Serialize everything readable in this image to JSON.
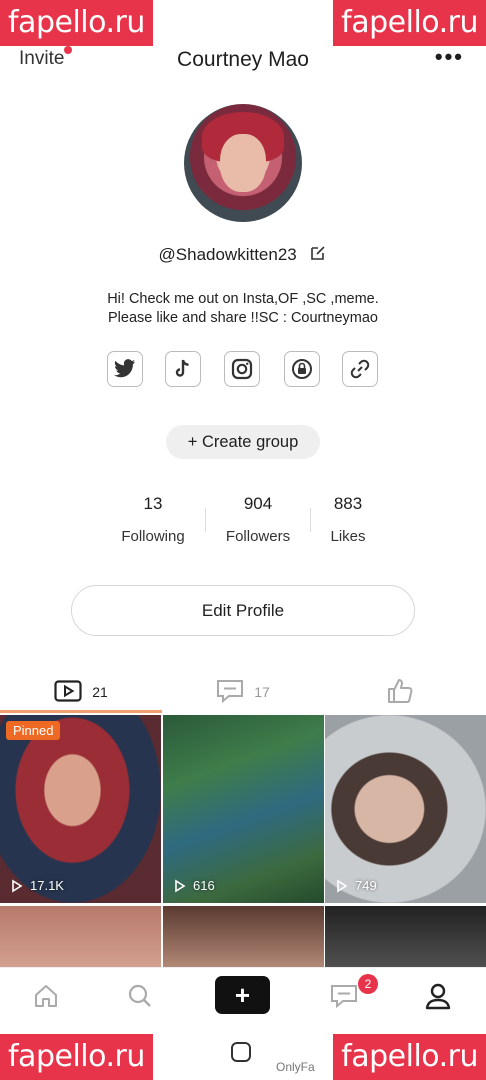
{
  "watermarks": {
    "text": "fapello.ru"
  },
  "header": {
    "invite_label": "Invite",
    "title": "Courtney Mao",
    "more_label": "•••"
  },
  "profile": {
    "username": "@Shadowkitten23",
    "bio_line1": "Hi! Check me out on Insta,OF ,SC ,meme.",
    "bio_line2": "Please like and share !!SC : Courtneymao",
    "socials": [
      "twitter-icon",
      "tiktok-icon",
      "instagram-icon",
      "onlyfans-icon",
      "link-icon"
    ],
    "create_group_label": "+ Create group"
  },
  "stats": [
    {
      "value": "13",
      "label": "Following"
    },
    {
      "value": "904",
      "label": "Followers"
    },
    {
      "value": "883",
      "label": "Likes"
    }
  ],
  "edit_profile_label": "Edit Profile",
  "tabs": [
    {
      "icon": "video-icon",
      "count": "21"
    },
    {
      "icon": "comment-icon",
      "count": "17"
    },
    {
      "icon": "like-icon",
      "count": ""
    }
  ],
  "videos": [
    {
      "pinned_label": "Pinned",
      "views": "17.1K"
    },
    {
      "views": "616"
    },
    {
      "views": "749"
    }
  ],
  "bottom_nav": {
    "items": [
      "home-icon",
      "search-icon",
      "create-icon",
      "messages-icon",
      "profile-icon"
    ],
    "messages_badge": "2",
    "create_label": "+"
  },
  "system_nav": {
    "app_label": "OnlyFa"
  },
  "colors": {
    "accent": "#e8344a",
    "pinned": "#ee6a24",
    "tab_underline": "#f0a070"
  }
}
